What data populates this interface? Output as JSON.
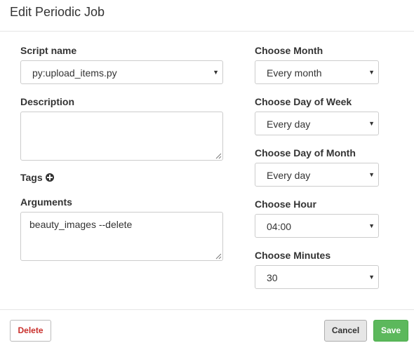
{
  "modal": {
    "title": "Edit Periodic Job"
  },
  "left": {
    "script_label": "Script name",
    "script_value": "py:upload_items.py",
    "description_label": "Description",
    "description_value": "",
    "tags_label": "Tags",
    "arguments_label": "Arguments",
    "arguments_value": "beauty_images --delete"
  },
  "right": {
    "month_label": "Choose Month",
    "month_value": "Every month",
    "dow_label": "Choose Day of Week",
    "dow_value": "Every day",
    "dom_label": "Choose Day of Month",
    "dom_value": "Every day",
    "hour_label": "Choose Hour",
    "hour_value": "04:00",
    "minutes_label": "Choose Minutes",
    "minutes_value": "30"
  },
  "icons": {
    "caret": "▼",
    "tags_add": "plus-circle-icon",
    "resize": "resize-grip-icon"
  },
  "footer": {
    "delete_label": "Delete",
    "cancel_label": "Cancel",
    "save_label": "Save"
  },
  "colors": {
    "danger": "#c9302c",
    "success": "#5cb85c",
    "border": "#cccccc"
  }
}
